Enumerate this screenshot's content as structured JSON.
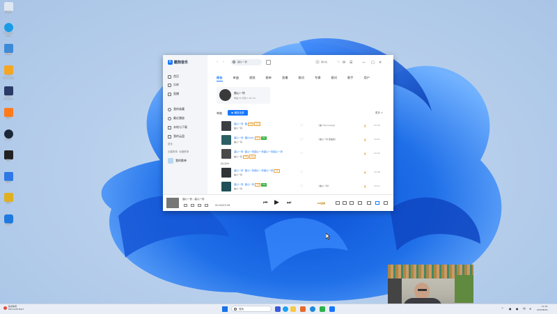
{
  "desktop": {
    "icons": [
      {
        "label": "回收站",
        "icon": "recycle-bin-icon",
        "color": "#dfe8f2"
      },
      {
        "label": "Microsoft Edge",
        "icon": "edge-icon",
        "color": "#1a9be6"
      },
      {
        "label": "此电脑",
        "icon": "computer-icon",
        "color": "#3d8ad8"
      },
      {
        "label": "Adobe Photoshop",
        "icon": "app-icon",
        "color": "#f5a623"
      },
      {
        "label": "Adobe Premiere",
        "icon": "app-icon",
        "color": "#2b3a67"
      },
      {
        "label": "应用",
        "icon": "app-icon",
        "color": "#ff7a1a"
      },
      {
        "label": "Steam",
        "icon": "steam-icon",
        "color": "#1b2838"
      },
      {
        "label": "应用",
        "icon": "app-icon",
        "color": "#222222"
      },
      {
        "label": "应用",
        "icon": "app-icon",
        "color": "#2f79e6"
      },
      {
        "label": "应用",
        "icon": "app-icon",
        "color": "#e0b020"
      },
      {
        "label": "酷狗",
        "icon": "kugou-icon",
        "color": "#1f7ae0"
      }
    ]
  },
  "app": {
    "brand": "酷狗音乐",
    "brand_color": "#1677ff",
    "nav": [
      {
        "label": "首页",
        "icon": "home-icon"
      },
      {
        "label": "乐库",
        "icon": "library-icon"
      },
      {
        "label": "直播",
        "icon": "live-icon"
      },
      {
        "label": "我的收藏",
        "icon": "heart-icon"
      },
      {
        "label": "最近播放",
        "icon": "clock-icon"
      },
      {
        "label": "本地与下载",
        "icon": "download-icon"
      },
      {
        "label": "我的云盘",
        "icon": "cloud-icon"
      }
    ],
    "more_label": "更多",
    "playlist_section": "创建歌单",
    "playlist_filter": "收藏歌单",
    "playlist_item": "我的歌单",
    "search_value": "曲心一铃",
    "user_name": "用户名",
    "tabs": [
      "综合",
      "单曲",
      "视频",
      "歌单",
      "直播",
      "歌词",
      "专辑",
      "歌词",
      "歌手",
      "用户"
    ],
    "active_tab": 0,
    "artist": {
      "name": "曲心一铃",
      "stats": "单曲 56 专辑 7 MV 32"
    },
    "songs_label": "单曲",
    "play_all_label": "▶ 播放全部",
    "more_link": "更多 >",
    "songs": [
      {
        "title": "曲心一铃 ·曲",
        "artist": "曲心一铃",
        "album": "《曲 The Loving》",
        "duration": "03:28",
        "badges": [
          "VIP",
          "原唱"
        ],
        "color": "#3a3f44"
      },
      {
        "title": "曲心一铃 ·曲(Live)",
        "artist": "曲心一铃",
        "album": "《曲心一铃 歌曲集》",
        "duration": "04:02",
        "badges": [
          "VIP",
          "HQ"
        ],
        "color": "#2b5f66"
      },
      {
        "title": "曲心一铃 ·曲心一铃曲心一铃曲心一铃曲心一铃",
        "artist": "曲心一铃",
        "album": "",
        "duration": "04:44",
        "badges": [
          "VIP",
          "原唱"
        ],
        "color": "#4a4a4a"
      },
      {
        "title": "曲心一铃 ·曲心一铃曲心一铃曲心一铃",
        "artist": "曲心一铃",
        "album": "",
        "duration": "03:48",
        "badges": [
          "VIP"
        ],
        "color": "#2f3438"
      },
      {
        "title": "曲心一铃 ·曲心一铃",
        "artist": "曲心一铃",
        "album": "《曲心一铃》",
        "duration": "04:11",
        "badges": [
          "VIP",
          "HQ"
        ],
        "color": "#1f4f58"
      }
    ],
    "sub_label": "相关歌单",
    "player": {
      "now_playing": "曲心一铃 - 曲心一铃",
      "time": "00:00/03:28",
      "quality": "HQ音质"
    }
  },
  "taskbar": {
    "weather_title": "热点新闻",
    "weather_sub": "Microsoft Start",
    "search_placeholder": "搜索",
    "clock_time": "11:22",
    "clock_date": "2023/8/16",
    "lang": "中"
  }
}
